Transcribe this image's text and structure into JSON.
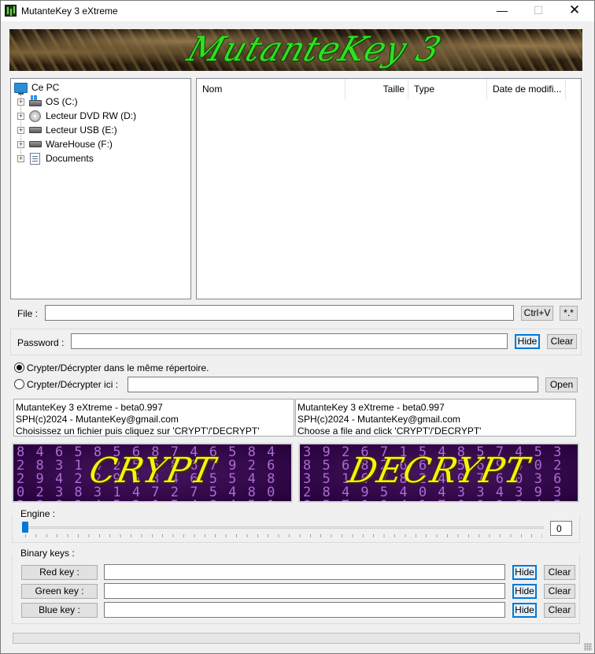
{
  "window": {
    "title": "MutanteKey 3 eXtreme",
    "minimize": "—",
    "maximize": "☐",
    "close": "✕"
  },
  "banner": {
    "title": "MutanteKey 3"
  },
  "tree": {
    "root": "Ce PC",
    "items": [
      {
        "label": "OS (C:)",
        "icon": "windows-drive-icon"
      },
      {
        "label": "Lecteur DVD RW (D:)",
        "icon": "dvd-drive-icon"
      },
      {
        "label": "Lecteur USB (E:)",
        "icon": "usb-drive-icon"
      },
      {
        "label": "WareHouse (F:)",
        "icon": "drive-icon"
      },
      {
        "label": "Documents",
        "icon": "documents-icon"
      }
    ]
  },
  "filelist": {
    "columns": [
      "Nom",
      "Taille",
      "Type",
      "Date de modifi..."
    ]
  },
  "file": {
    "label": "File :",
    "value": "",
    "ctrlv": "Ctrl+V",
    "wildcard": "*.*"
  },
  "password": {
    "label": "Password :",
    "value": "",
    "hide": "Hide",
    "clear": "Clear"
  },
  "output": {
    "same_dir": "Crypter/Décrypter dans le même répertoire.",
    "here": "Crypter/Décrypter ici :",
    "here_value": "",
    "open": "Open",
    "selected": "same_dir"
  },
  "messages": {
    "fr": [
      "MutanteKey 3 eXtreme - beta0.997",
      "SPH(c)2024 - MutanteKey@gmail.com",
      "Choisissez un fichier puis cliquez sur 'CRYPT'/'DECRYPT'"
    ],
    "en": [
      "MutanteKey 3 eXtreme - beta0.997",
      "SPH(c)2024 - MutanteKey@gmail.com",
      "Choose a file and click 'CRYPT'/'DECRYPT'"
    ]
  },
  "actions": {
    "crypt": "CRYPT",
    "decrypt": "DECRYPT"
  },
  "engine": {
    "label": "Engine :",
    "value": "0",
    "level": 0
  },
  "binary_keys": {
    "label": "Binary keys :",
    "keys": [
      {
        "name": "Red key :",
        "value": "",
        "hide": "Hide",
        "clear": "Clear"
      },
      {
        "name": "Green key :",
        "value": "",
        "hide": "Hide",
        "clear": "Clear"
      },
      {
        "name": "Blue key :",
        "value": "",
        "hide": "Hide",
        "clear": "Clear"
      }
    ]
  },
  "colors": {
    "accent": "#0078d7",
    "banner_text": "#30e01f",
    "button_text": "#f6f20e",
    "matrix": "#c27cf0"
  }
}
